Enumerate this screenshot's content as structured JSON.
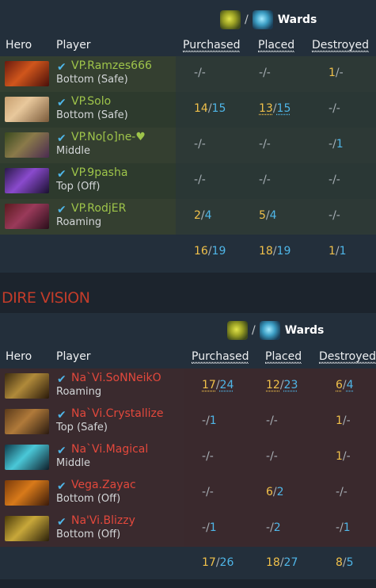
{
  "radiant": {
    "wards_label": "Wards",
    "ward_sep": "/",
    "headers": {
      "hero": "Hero",
      "player": "Player",
      "purchased": "Purchased",
      "placed": "Placed",
      "destroyed": "Destroyed"
    },
    "players": [
      {
        "name": "VP.Ramzes666",
        "role": "Bottom (Safe)",
        "purchased": [
          "-",
          "-"
        ],
        "placed": [
          "-",
          "-"
        ],
        "destroyed": [
          "1",
          "-"
        ]
      },
      {
        "name": "VP.Solo",
        "role": "Bottom (Safe)",
        "purchased": [
          "14",
          "15"
        ],
        "placed": [
          "13",
          "15"
        ],
        "destroyed": [
          "-",
          "-"
        ]
      },
      {
        "name": "VP.No[o]ne-♥",
        "role": "Middle",
        "purchased": [
          "-",
          "-"
        ],
        "placed": [
          "-",
          "-"
        ],
        "destroyed": [
          "-",
          "1"
        ]
      },
      {
        "name": "VP.9pasha",
        "role": "Top (Off)",
        "purchased": [
          "-",
          "-"
        ],
        "placed": [
          "-",
          "-"
        ],
        "destroyed": [
          "-",
          "-"
        ]
      },
      {
        "name": "VP.RodjER",
        "role": "Roaming",
        "purchased": [
          "2",
          "4"
        ],
        "placed": [
          "5",
          "4"
        ],
        "destroyed": [
          "-",
          "-"
        ]
      }
    ],
    "totals": {
      "purchased": [
        "16",
        "19"
      ],
      "placed": [
        "18",
        "19"
      ],
      "destroyed": [
        "1",
        "1"
      ]
    }
  },
  "dire": {
    "section_title": "DIRE VISION",
    "wards_label": "Wards",
    "ward_sep": "/",
    "headers": {
      "hero": "Hero",
      "player": "Player",
      "purchased": "Purchased",
      "placed": "Placed",
      "destroyed": "Destroyed"
    },
    "players": [
      {
        "name": "Na`Vi.SoNNeikO",
        "role": "Roaming",
        "purchased": [
          "17",
          "24"
        ],
        "placed": [
          "12",
          "23"
        ],
        "destroyed": [
          "6",
          "4"
        ]
      },
      {
        "name": "Na`Vi.Crystallize",
        "role": "Top (Safe)",
        "purchased": [
          "-",
          "1"
        ],
        "placed": [
          "-",
          "-"
        ],
        "destroyed": [
          "1",
          "-"
        ]
      },
      {
        "name": "Na`Vi.Magical",
        "role": "Middle",
        "purchased": [
          "-",
          "-"
        ],
        "placed": [
          "-",
          "-"
        ],
        "destroyed": [
          "1",
          "-"
        ]
      },
      {
        "name": "Vega.Zayac",
        "role": "Bottom (Off)",
        "purchased": [
          "-",
          "-"
        ],
        "placed": [
          "6",
          "2"
        ],
        "destroyed": [
          "-",
          "-"
        ]
      },
      {
        "name": "Na'Vi.Blizzy",
        "role": "Bottom (Off)",
        "purchased": [
          "-",
          "1"
        ],
        "placed": [
          "-",
          "2"
        ],
        "destroyed": [
          "-",
          "1"
        ]
      }
    ],
    "totals": {
      "purchased": [
        "17",
        "26"
      ],
      "placed": [
        "18",
        "27"
      ],
      "destroyed": [
        "8",
        "5"
      ]
    }
  },
  "icons": {
    "observer_ward": "observer-ward-icon",
    "sentry_ward": "sentry-ward-icon",
    "verified": "checkmark-icon"
  },
  "colors": {
    "radiant_name": "#9ec44a",
    "dire_name": "#e2483c",
    "observer_value": "#f0c04a",
    "sentry_value": "#4fb6e8",
    "section_title": "#c23c2a"
  }
}
